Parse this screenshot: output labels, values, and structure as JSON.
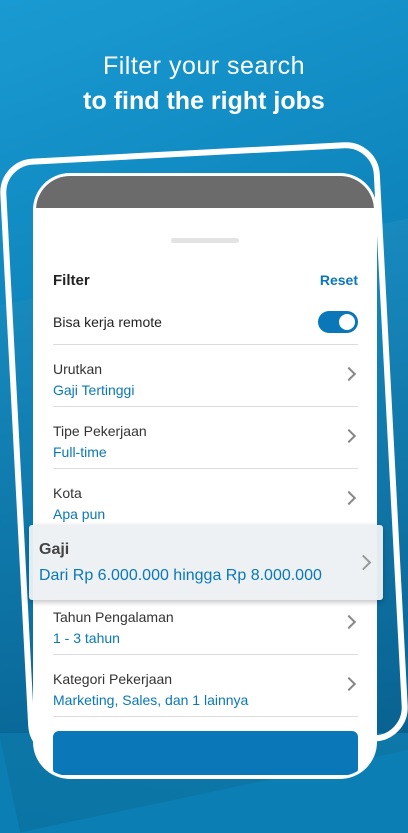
{
  "headline": {
    "line1": "Filter your search",
    "line2": "to find the right jobs"
  },
  "filter": {
    "title": "Filter",
    "reset_label": "Reset",
    "remote": {
      "label": "Bisa kerja remote",
      "enabled": true
    },
    "items": [
      {
        "title": "Urutkan",
        "value": "Gaji Tertinggi"
      },
      {
        "title": "Tipe Pekerjaan",
        "value": "Full-time"
      },
      {
        "title": "Kota",
        "value": "Apa pun"
      },
      {
        "title": "Gaji",
        "value": "Dari Rp 6.000.000 hingga Rp 8.000.000"
      },
      {
        "title": "Tahun Pengalaman",
        "value": "1 - 3 tahun"
      },
      {
        "title": "Kategori Pekerjaan",
        "value": "Marketing, Sales, dan 1 lainnya"
      }
    ]
  },
  "colors": {
    "accent": "#0a78b8",
    "background": "#0c82b9"
  },
  "icons": {
    "row_arrow": "chevron-right-icon"
  }
}
